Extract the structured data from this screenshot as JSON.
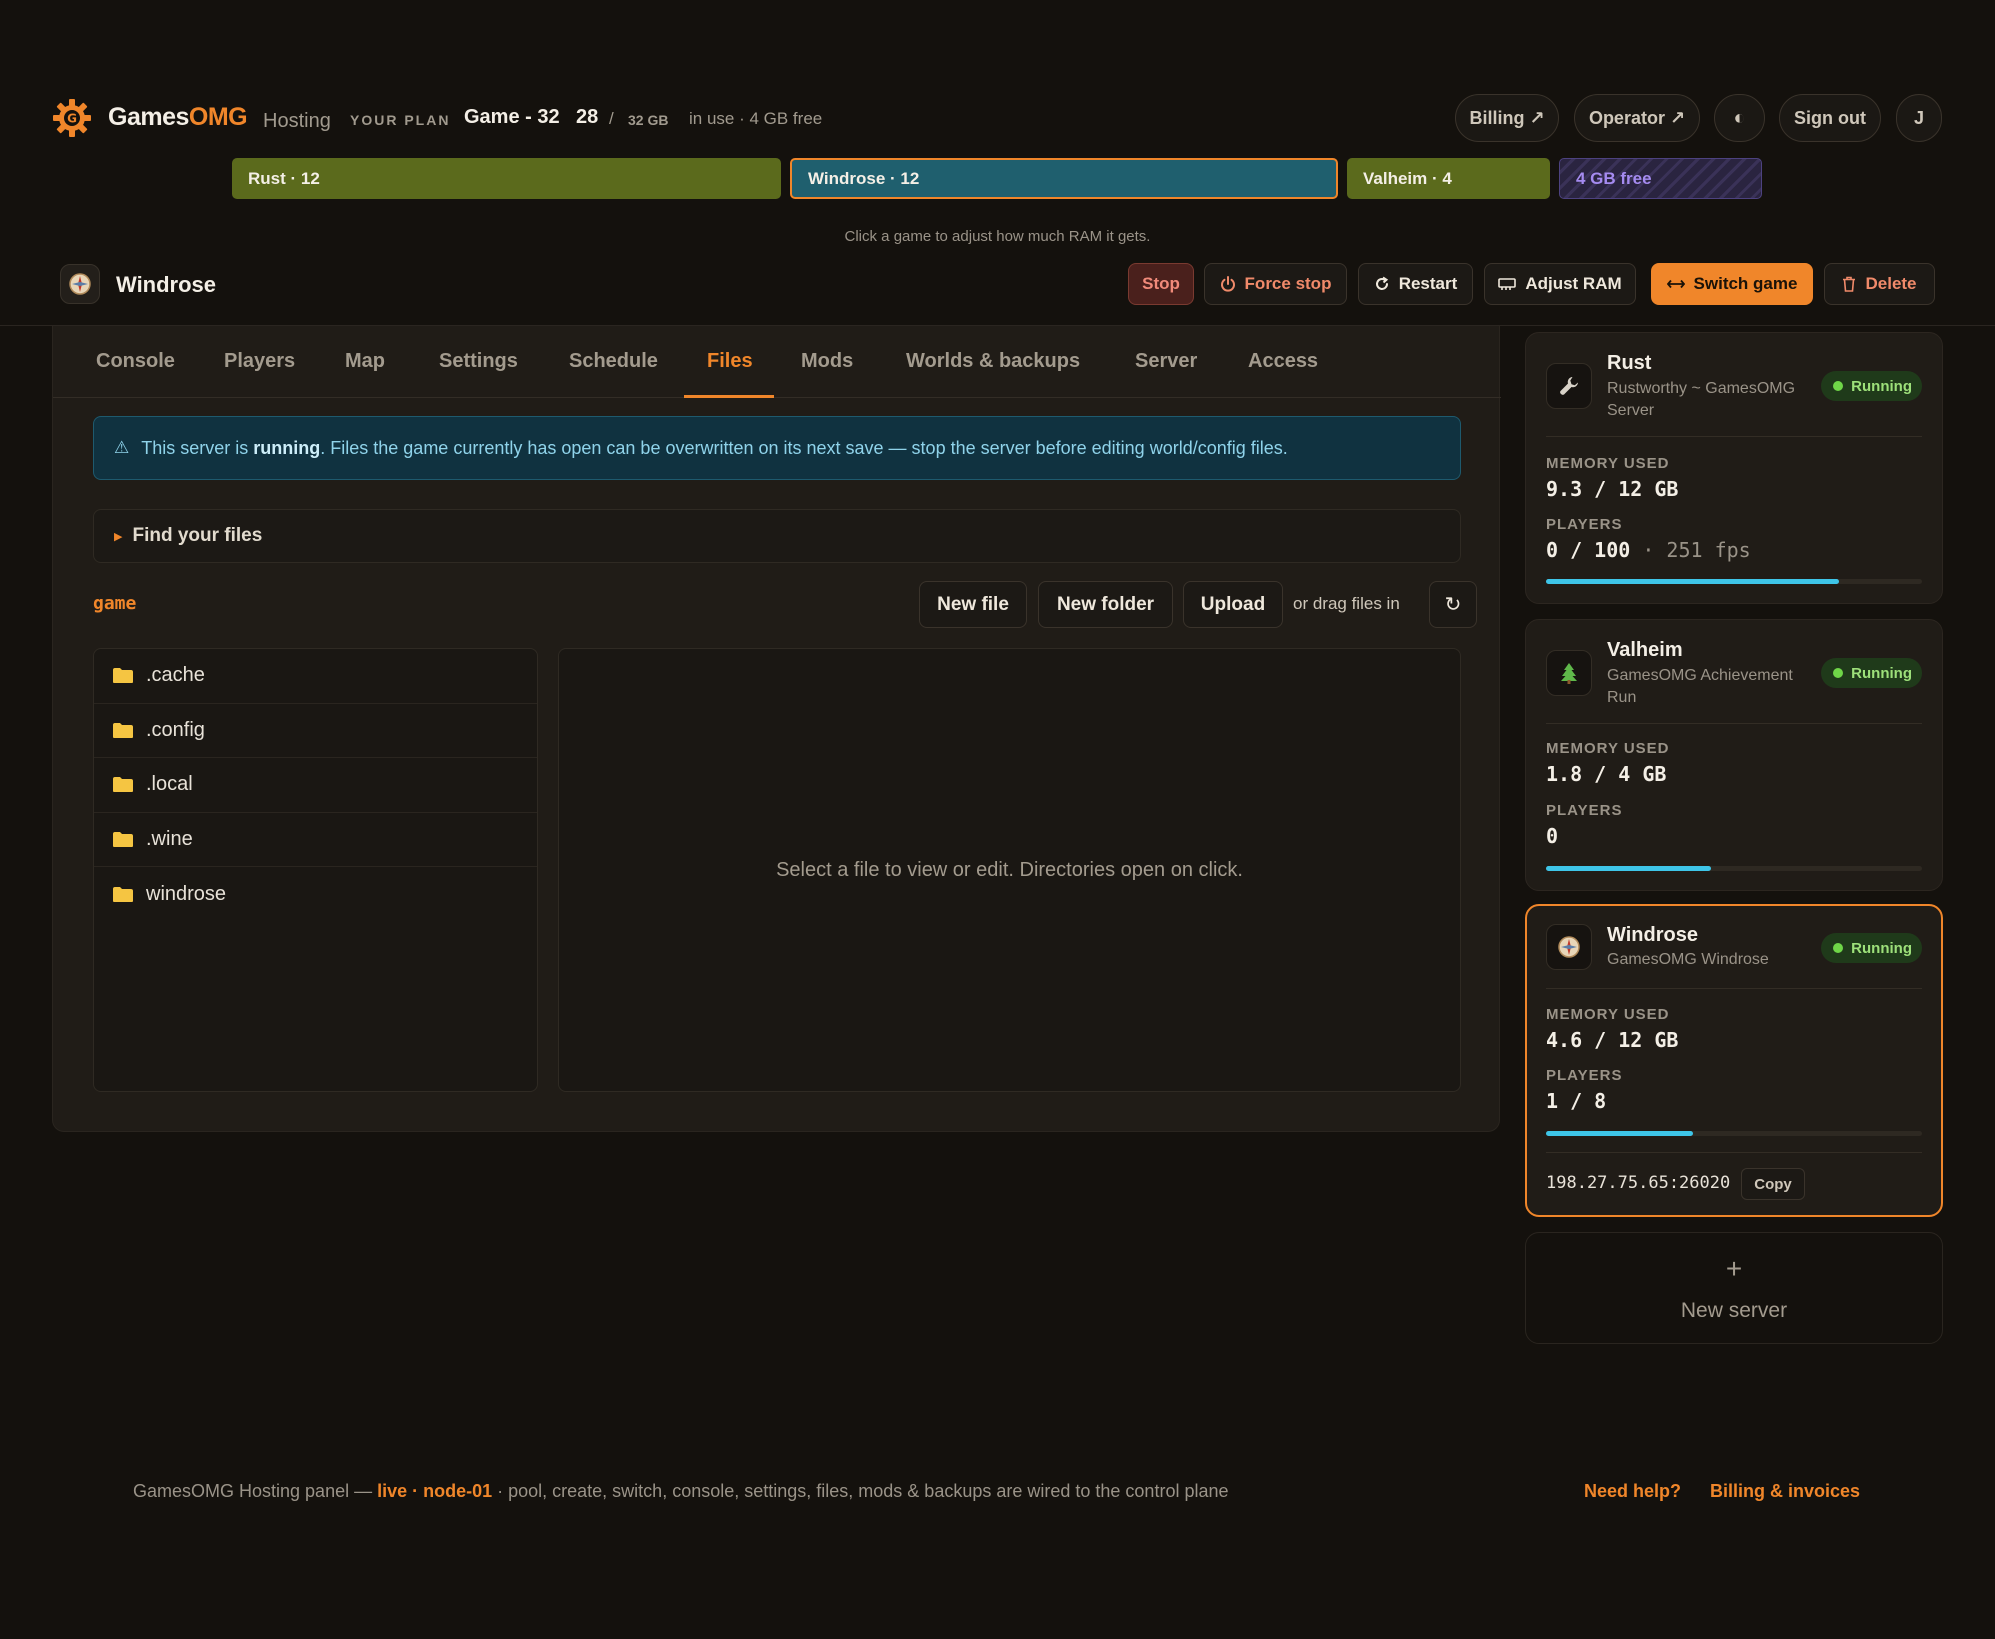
{
  "header": {
    "brand_a": "Games",
    "brand_b": "OMG",
    "brand_suffix": "Hosting",
    "plan_label": "YOUR PLAN",
    "plan_name": "Game - 32",
    "plan_used": "28",
    "plan_slash": "/",
    "plan_total": "32 GB",
    "plan_free": "in use · 4 GB free",
    "billing": "Billing ↗",
    "operator": "Operator ↗",
    "theme_icon": "◐",
    "sign_out": "Sign out",
    "avatar": "J"
  },
  "ram_bar": {
    "segments": [
      {
        "label": "Rust · 12",
        "gb": 12,
        "color": "#5b6a1c"
      },
      {
        "label": "Windrose · 12",
        "gb": 12,
        "color": "#1f5f6e"
      },
      {
        "label": "Valheim · 4",
        "gb": 4,
        "color": "#5b6a1c"
      },
      {
        "label": "4 GB free",
        "gb": 4,
        "color": "#2a2440"
      }
    ],
    "hint": "Click a game to adjust how much RAM it gets."
  },
  "server": {
    "name": "Windrose",
    "actions": {
      "stop": "Stop",
      "force_stop": "Force stop",
      "restart": "Restart",
      "adjust_ram": "Adjust RAM",
      "switch_game": "Switch game",
      "delete": "Delete"
    }
  },
  "tabs": [
    "Console",
    "Players",
    "Map",
    "Settings",
    "Schedule",
    "Files",
    "Mods",
    "Worlds & backups",
    "Server",
    "Access"
  ],
  "active_tab": "Files",
  "alert": {
    "pre": "This server is ",
    "bold": "running",
    "post": ". Files the game currently has open can be overwritten on its next save — stop the server before editing world/config files."
  },
  "find_files": "Find your files",
  "files": {
    "path": "game",
    "new_file": "New file",
    "new_folder": "New folder",
    "upload": "Upload",
    "drag_hint": "or drag files in",
    "refresh_icon": "↻",
    "items": [
      ".cache",
      ".config",
      ".local",
      ".wine",
      "windrose"
    ],
    "preview_placeholder": "Select a file to view or edit. Directories open on click."
  },
  "cards": [
    {
      "name": "Rust",
      "sub": "Rustworthy ~ GamesOMG Server",
      "status": "Running",
      "mem_label": "MEMORY USED",
      "mem": "9.3 / 12 GB",
      "players_label": "PLAYERS",
      "players": "0 / 100",
      "fps": "· 251 fps",
      "usage": 0.78,
      "icon": "wrench-icon"
    },
    {
      "name": "Valheim",
      "sub": "GamesOMG Achievement Run",
      "status": "Running",
      "mem_label": "MEMORY USED",
      "mem": "1.8 / 4 GB",
      "players_label": "PLAYERS",
      "players": "0",
      "usage": 0.44,
      "icon": "tree-icon"
    },
    {
      "name": "Windrose",
      "sub": "GamesOMG Windrose",
      "status": "Running",
      "mem_label": "MEMORY USED",
      "mem": "4.6 / 12 GB",
      "players_label": "PLAYERS",
      "players": "1 / 8",
      "usage": 0.39,
      "ip": "198.27.75.65:26020",
      "copy": "Copy",
      "icon": "compass-icon"
    }
  ],
  "new_server": {
    "plus": "+",
    "label": "New server"
  },
  "footer": {
    "pre": "GamesOMG Hosting panel — ",
    "live": "live · node-01",
    "post": " · pool, create, switch, console, settings, files, mods & backups are wired to the control plane",
    "help": "Need help?",
    "billing": "Billing & invoices"
  },
  "colors": {
    "accent": "#f0862a",
    "running": "#6fd648",
    "bar": "#3ec5e8"
  }
}
